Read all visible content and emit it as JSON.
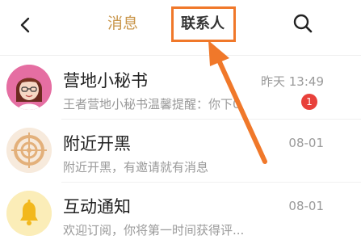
{
  "header": {
    "tabs": [
      {
        "label": "消息",
        "active": true
      },
      {
        "label": "联系人",
        "active": false
      }
    ],
    "back_icon": "chevron-left-icon",
    "search_icon": "search-icon"
  },
  "colors": {
    "active_tab": "#c9964b",
    "highlight": "#f0782a",
    "badge": "#e8413b"
  },
  "messages": [
    {
      "title": "营地小秘书",
      "subtitle": "王者营地小秘书温馨提醒：你下0",
      "time": "昨天 13:49",
      "badge": "1",
      "avatar": "secretary-avatar"
    },
    {
      "title": "附近开黑",
      "subtitle": "附近开黑，有邀请就有消息",
      "time": "08-01",
      "avatar": "target-icon"
    },
    {
      "title": "互动通知",
      "subtitle": "欢迎订阅，你将第一时间获得评...",
      "time": "08-01",
      "avatar": "bell-icon"
    }
  ]
}
